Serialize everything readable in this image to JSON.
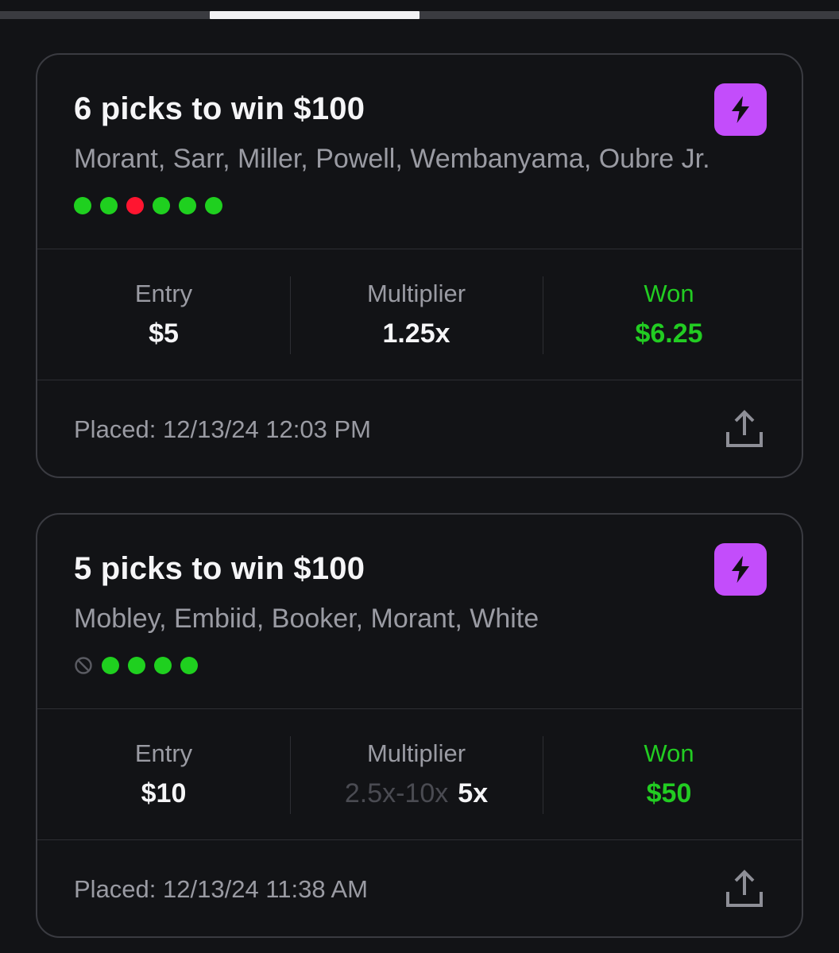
{
  "cards": [
    {
      "title": "6 picks to win $100",
      "players": "Morant, Sarr, Miller, Powell, Wembanyama, Oubre Jr.",
      "pick_results": [
        "win",
        "win",
        "loss",
        "win",
        "win",
        "win"
      ],
      "entry_label": "Entry",
      "entry_value": "$5",
      "multiplier_label": "Multiplier",
      "multiplier_range": "",
      "multiplier_value": "1.25x",
      "won_label": "Won",
      "won_value": "$6.25",
      "placed": "Placed: 12/13/24 12:03 PM"
    },
    {
      "title": "5 picks to win $100",
      "players": "Mobley, Embiid, Booker, Morant, White",
      "pick_results": [
        "void",
        "win",
        "win",
        "win",
        "win"
      ],
      "entry_label": "Entry",
      "entry_value": "$10",
      "multiplier_label": "Multiplier",
      "multiplier_range": "2.5x-10x",
      "multiplier_value": "5x",
      "won_label": "Won",
      "won_value": "$50",
      "placed": "Placed: 12/13/24 11:38 AM"
    }
  ],
  "colors": {
    "background": "#121316",
    "boost_badge": "#c34dfb",
    "win": "#1fd01f",
    "loss": "#ff1530",
    "won_text": "#22cc22",
    "secondary_text": "#9a9ba3"
  },
  "icons": {
    "boost": "lightning-bolt-icon",
    "share": "share-upload-icon",
    "void_pick": "void-circle-icon"
  }
}
